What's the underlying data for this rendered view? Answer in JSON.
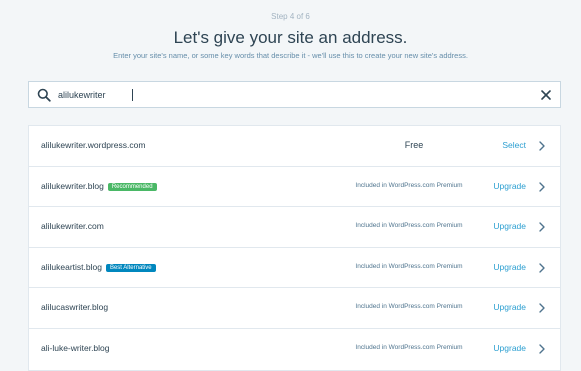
{
  "header": {
    "step": "Step 4 of 6",
    "title": "Let's give your site an address.",
    "subtitle": "Enter your site's name, or some key words that describe it - we'll use this to create your new site's address."
  },
  "search": {
    "value": "alilukewriter",
    "placeholder": ""
  },
  "colors": {
    "recommended_badge": "#4ab866",
    "best_alternative_badge": "#0087be",
    "action_link": "#2c9fd1"
  },
  "results": [
    {
      "domain": "alilukewriter.wordpress.com",
      "badge": "",
      "price": "Free",
      "action": "Select"
    },
    {
      "domain": "alilukewriter.blog",
      "badge": "Recommended",
      "price": "Included in WordPress.com Premium",
      "action": "Upgrade"
    },
    {
      "domain": "alilukewriter.com",
      "badge": "",
      "price": "Included in WordPress.com Premium",
      "action": "Upgrade"
    },
    {
      "domain": "alilukeartist.blog",
      "badge": "Best Alternative",
      "price": "Included in WordPress.com Premium",
      "action": "Upgrade"
    },
    {
      "domain": "alilucaswriter.blog",
      "badge": "",
      "price": "Included in WordPress.com Premium",
      "action": "Upgrade"
    },
    {
      "domain": "ali-luke-writer.blog",
      "badge": "",
      "price": "Included in WordPress.com Premium",
      "action": "Upgrade"
    }
  ]
}
